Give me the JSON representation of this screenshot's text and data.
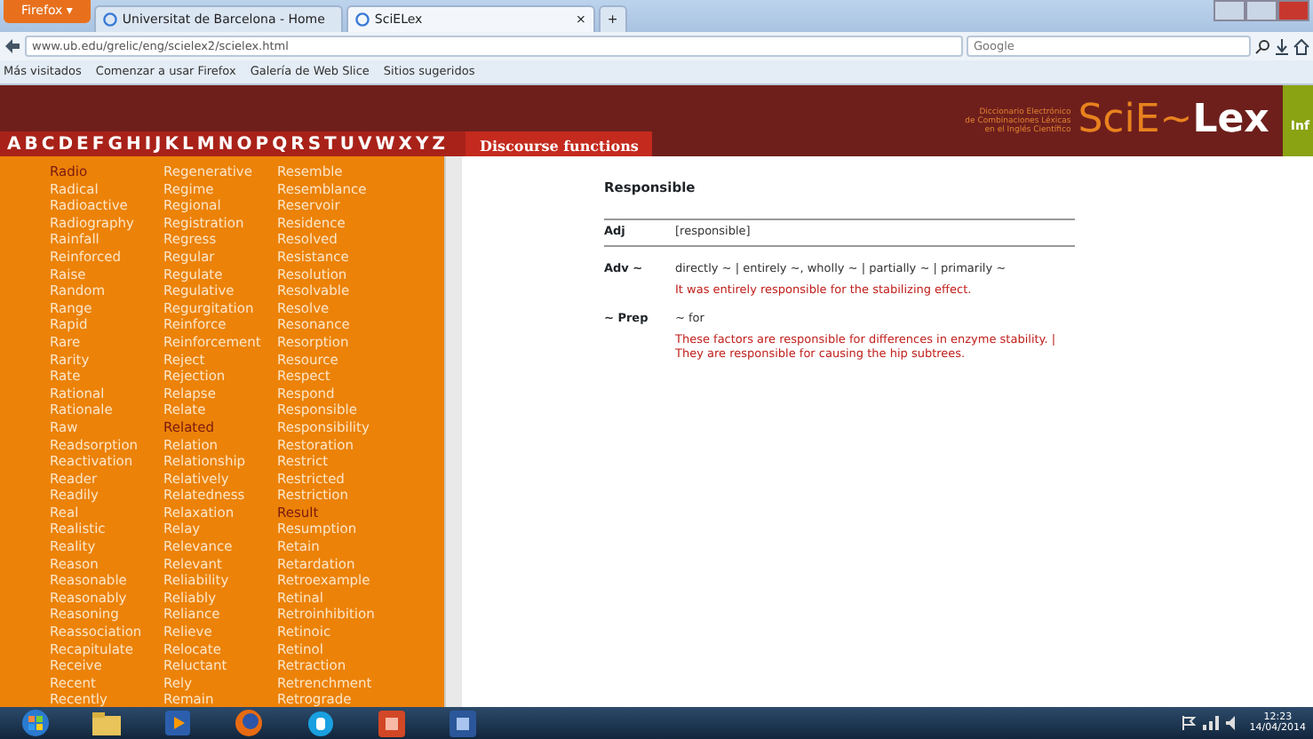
{
  "browser": {
    "menu_button": "Firefox ▾",
    "tabs": [
      {
        "label": "Universitat de Barcelona - Home",
        "selected": false
      },
      {
        "label": "SciELex",
        "selected": true
      }
    ],
    "new_tab": "+",
    "close_tab": "×",
    "address": "www.ub.edu/grelic/eng/scielex2/scielex.html",
    "search_placeholder": "Google",
    "bookmarks": [
      "Más visitados",
      "Comenzar a usar Firefox",
      "Galería de Web Slice",
      "Sitios sugeridos"
    ]
  },
  "header": {
    "letters": [
      "A",
      "B",
      "C",
      "D",
      "E",
      "F",
      "G",
      "H",
      "I",
      "J",
      "K",
      "L",
      "M",
      "N",
      "O",
      "P",
      "Q",
      "R",
      "S",
      "T",
      "U",
      "V",
      "W",
      "X",
      "Y",
      "Z"
    ],
    "section_tab": "Discourse functions",
    "subtitle": [
      "Diccionario Electrónico",
      "de Combinaciones Léxicas",
      "en el Inglés Científico"
    ],
    "logo": "SciE~**Lex**",
    "side_tab": "Inf"
  },
  "word_columns": [
    [
      {
        "text": "Radio",
        "visited": true
      },
      {
        "text": "Radical",
        "visited": false
      },
      {
        "text": "Radioactive",
        "visited": false
      },
      {
        "text": "Radiography",
        "visited": false
      },
      {
        "text": "Rainfall",
        "visited": false
      },
      {
        "text": "Reinforced",
        "visited": false
      },
      {
        "text": "Raise",
        "visited": false
      },
      {
        "text": "Random",
        "visited": false
      },
      {
        "text": "Range",
        "visited": false
      },
      {
        "text": "Rapid",
        "visited": false
      },
      {
        "text": "Rare",
        "visited": false
      },
      {
        "text": "Rarity",
        "visited": false
      },
      {
        "text": "Rate",
        "visited": false
      },
      {
        "text": "Rational",
        "visited": false
      },
      {
        "text": "Rationale",
        "visited": false
      },
      {
        "text": "Raw",
        "visited": false
      },
      {
        "text": "Readsorption",
        "visited": false
      },
      {
        "text": "Reactivation",
        "visited": false
      },
      {
        "text": "Reader",
        "visited": false
      },
      {
        "text": "Readily",
        "visited": false
      },
      {
        "text": "Real",
        "visited": false
      },
      {
        "text": "Realistic",
        "visited": false
      },
      {
        "text": "Reality",
        "visited": false
      },
      {
        "text": "Reason",
        "visited": false
      },
      {
        "text": "Reasonable",
        "visited": false
      },
      {
        "text": "Reasonably",
        "visited": false
      },
      {
        "text": "Reasoning",
        "visited": false
      },
      {
        "text": "Reassociation",
        "visited": false
      },
      {
        "text": "Recapitulate",
        "visited": false
      },
      {
        "text": "Receive",
        "visited": false
      },
      {
        "text": "Recent",
        "visited": false
      },
      {
        "text": "Recently",
        "visited": false
      }
    ],
    [
      {
        "text": "Regenerative",
        "visited": false
      },
      {
        "text": "Regime",
        "visited": false
      },
      {
        "text": "Regional",
        "visited": false
      },
      {
        "text": "Registration",
        "visited": false
      },
      {
        "text": "Regress",
        "visited": false
      },
      {
        "text": "Regular",
        "visited": false
      },
      {
        "text": "Regulate",
        "visited": false
      },
      {
        "text": "Regulative",
        "visited": false
      },
      {
        "text": "Regurgitation",
        "visited": false
      },
      {
        "text": "Reinforce",
        "visited": false
      },
      {
        "text": "Reinforcement",
        "visited": false
      },
      {
        "text": "Reject",
        "visited": false
      },
      {
        "text": "Rejection",
        "visited": false
      },
      {
        "text": "Relapse",
        "visited": false
      },
      {
        "text": "Relate",
        "visited": false
      },
      {
        "text": "Related",
        "visited": true
      },
      {
        "text": "Relation",
        "visited": false
      },
      {
        "text": "Relationship",
        "visited": false
      },
      {
        "text": "Relatively",
        "visited": false
      },
      {
        "text": "Relatedness",
        "visited": false
      },
      {
        "text": "Relaxation",
        "visited": false
      },
      {
        "text": "Relay",
        "visited": false
      },
      {
        "text": "Relevance",
        "visited": false
      },
      {
        "text": "Relevant",
        "visited": false
      },
      {
        "text": "Reliability",
        "visited": false
      },
      {
        "text": "Reliably",
        "visited": false
      },
      {
        "text": "Reliance",
        "visited": false
      },
      {
        "text": "Relieve",
        "visited": false
      },
      {
        "text": "Relocate",
        "visited": false
      },
      {
        "text": "Reluctant",
        "visited": false
      },
      {
        "text": "Rely",
        "visited": false
      },
      {
        "text": "Remain",
        "visited": false
      }
    ],
    [
      {
        "text": "Resemble",
        "visited": false
      },
      {
        "text": "Resemblance",
        "visited": false
      },
      {
        "text": "Reservoir",
        "visited": false
      },
      {
        "text": "Residence",
        "visited": false
      },
      {
        "text": "Resolved",
        "visited": false
      },
      {
        "text": "Resistance",
        "visited": false
      },
      {
        "text": "Resolution",
        "visited": false
      },
      {
        "text": "Resolvable",
        "visited": false
      },
      {
        "text": "Resolve",
        "visited": false
      },
      {
        "text": "Resonance",
        "visited": false
      },
      {
        "text": "Resorption",
        "visited": false
      },
      {
        "text": "Resource",
        "visited": false
      },
      {
        "text": "Respect",
        "visited": false
      },
      {
        "text": "Respond",
        "visited": false
      },
      {
        "text": "Responsible",
        "visited": false
      },
      {
        "text": "Responsibility",
        "visited": false
      },
      {
        "text": "Restoration",
        "visited": false
      },
      {
        "text": "Restrict",
        "visited": false
      },
      {
        "text": "Restricted",
        "visited": false
      },
      {
        "text": "Restriction",
        "visited": false
      },
      {
        "text": "Result",
        "visited": true
      },
      {
        "text": "Resumption",
        "visited": false
      },
      {
        "text": "Retain",
        "visited": false
      },
      {
        "text": "Retardation",
        "visited": false
      },
      {
        "text": "Retroexample",
        "visited": false
      },
      {
        "text": "Retinal",
        "visited": false
      },
      {
        "text": "Retroinhibition",
        "visited": false
      },
      {
        "text": "Retinoic",
        "visited": false
      },
      {
        "text": "Retinol",
        "visited": false
      },
      {
        "text": "Retraction",
        "visited": false
      },
      {
        "text": "Retrenchment",
        "visited": false
      },
      {
        "text": "Retrograde",
        "visited": false
      }
    ]
  ],
  "entry": {
    "headword": "Responsible",
    "pos": {
      "label": "Adj",
      "form": "[responsible]"
    },
    "collocations": [
      {
        "label": "Adv ~",
        "patterns": "directly ~ | entirely ~, wholly ~ | partially ~ | primarily ~",
        "examples": [
          "It was entirely responsible for the stabilizing effect."
        ]
      },
      {
        "label": "~ Prep",
        "patterns": "~ for",
        "examples": [
          "These factors are responsible for differences in enzyme stability. |",
          "They are responsible for causing the hip subtrees."
        ]
      }
    ]
  },
  "taskbar": {
    "time": "12:23",
    "date": "14/04/2014"
  }
}
